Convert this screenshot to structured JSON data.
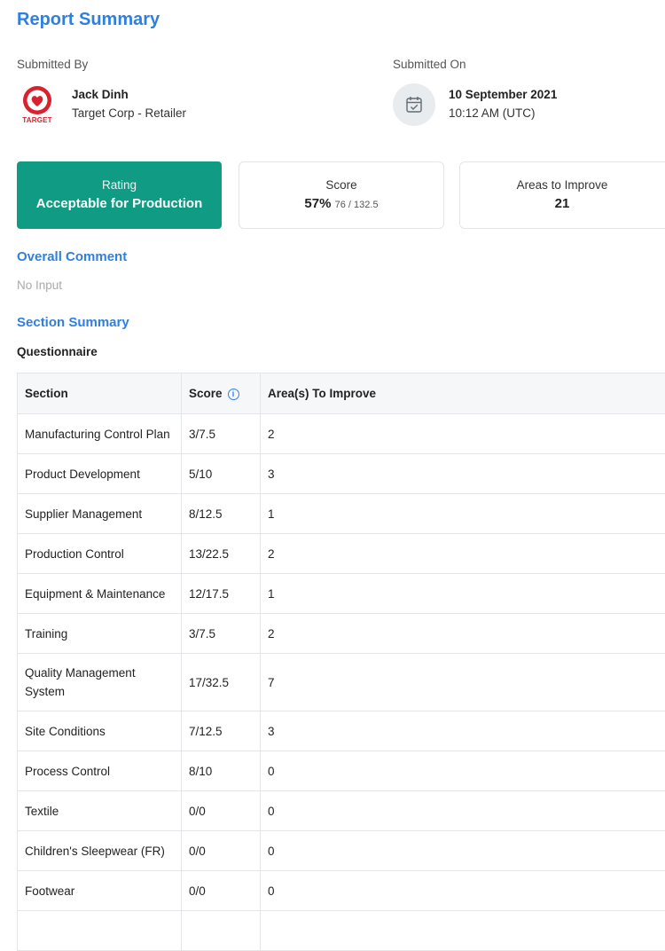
{
  "page": {
    "title": "Report Summary"
  },
  "submitted_by": {
    "label": "Submitted By",
    "name": "Jack Dinh",
    "org": "Target Corp - Retailer",
    "logo_text": "TARGET",
    "logo_icon": "target-logo"
  },
  "submitted_on": {
    "label": "Submitted On",
    "date": "10 September 2021",
    "time": "10:12 AM (UTC)",
    "icon": "calendar-check-icon"
  },
  "cards": {
    "rating": {
      "label": "Rating",
      "value": "Acceptable for Production",
      "color": "#0f9b84"
    },
    "score": {
      "label": "Score",
      "percent": "57%",
      "detail": "76 / 132.5"
    },
    "areas": {
      "label": "Areas to Improve",
      "value": "21"
    }
  },
  "overall_comment": {
    "title": "Overall Comment",
    "value": "No Input"
  },
  "section_summary": {
    "title": "Section Summary",
    "subtitle": "Questionnaire",
    "columns": [
      "Section",
      "Score",
      "Area(s) To Improve"
    ],
    "rows": [
      {
        "section": "Manufacturing Control Plan",
        "score": "3/7.5",
        "areas": "2"
      },
      {
        "section": "Product Development",
        "score": "5/10",
        "areas": "3"
      },
      {
        "section": "Supplier Management",
        "score": "8/12.5",
        "areas": "1"
      },
      {
        "section": "Production Control",
        "score": "13/22.5",
        "areas": "2"
      },
      {
        "section": "Equipment & Maintenance",
        "score": "12/17.5",
        "areas": "1"
      },
      {
        "section": "Training",
        "score": "3/7.5",
        "areas": "2"
      },
      {
        "section": "Quality Management System",
        "score": "17/32.5",
        "areas": "7"
      },
      {
        "section": "Site Conditions",
        "score": "7/12.5",
        "areas": "3"
      },
      {
        "section": "Process Control",
        "score": "8/10",
        "areas": "0"
      },
      {
        "section": "Textile",
        "score": "0/0",
        "areas": "0"
      },
      {
        "section": "Children's Sleepwear (FR)",
        "score": "0/0",
        "areas": "0"
      },
      {
        "section": "Footwear",
        "score": "0/0",
        "areas": "0"
      }
    ]
  },
  "colors": {
    "accent": "#2f7fe0",
    "rating": "#0f9b84",
    "brand": "#d9212f"
  }
}
